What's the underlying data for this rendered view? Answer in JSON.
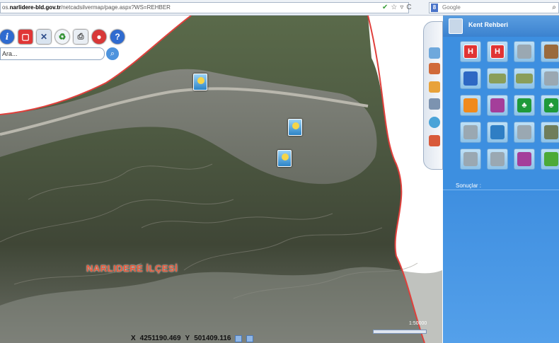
{
  "browser": {
    "url_prefix": "os.",
    "url_domain": "narlidere-bld.gov.tr",
    "url_path": "/netcadsilvermap/page.aspx?WS=REHBER",
    "search_engine_label": "Google",
    "url_icons": {
      "secure": "shield-check-icon",
      "bookmark": "star-icon",
      "dropdown": "chevron-down-icon",
      "reload": "reload-icon"
    }
  },
  "map": {
    "search_placeholder": "Ara...",
    "district_label": "NARLIDERE İLÇESİ",
    "coordinates": {
      "x_label": "X",
      "x_value": "4251190.469",
      "y_label": "Y",
      "y_value": "501409.116"
    },
    "scale_text": "1:50000",
    "toolbar_icons": [
      "info-icon",
      "square-icon",
      "cross-tools-icon",
      "recycle-icon",
      "print-icon",
      "stop-icon",
      "help-icon"
    ],
    "markers": [
      "location-marker",
      "location-marker",
      "location-marker"
    ],
    "colors": {
      "boundary": "#e0403c",
      "sea": "#ffffff"
    }
  },
  "panel": {
    "title": "Kent Rehberi",
    "results_label": "Sonuçlar :",
    "categories": [
      {
        "icon": "hospital-icon",
        "glyph": "H",
        "style": "ci-hosp"
      },
      {
        "icon": "hospital-icon",
        "glyph": "H",
        "style": "ci-hosp"
      },
      {
        "icon": "building-icon",
        "glyph": "",
        "style": "ci-gray"
      },
      {
        "icon": "fuel-icon",
        "glyph": "",
        "style": "ci-brown"
      },
      {
        "icon": "police-icon",
        "glyph": "",
        "style": "ci-blue"
      },
      {
        "icon": "park-icon",
        "glyph": "",
        "style": "ci-park"
      },
      {
        "icon": "park-icon",
        "glyph": "",
        "style": "ci-park"
      },
      {
        "icon": "building-icon",
        "glyph": "",
        "style": "ci-gray"
      },
      {
        "icon": "sport-icon",
        "glyph": "",
        "style": "ci-orange"
      },
      {
        "icon": "theatre-icon",
        "glyph": "",
        "style": "ci-purple"
      },
      {
        "icon": "forest-icon",
        "glyph": "♣",
        "style": "ci-green"
      },
      {
        "icon": "forest-icon",
        "glyph": "♣",
        "style": "ci-green"
      },
      {
        "icon": "building-icon",
        "glyph": "",
        "style": "ci-gray"
      },
      {
        "icon": "school-icon",
        "glyph": "",
        "style": "ci-teal"
      },
      {
        "icon": "building-icon",
        "glyph": "",
        "style": "ci-gray"
      },
      {
        "icon": "monument-icon",
        "glyph": "",
        "style": "ci-olive"
      },
      {
        "icon": "building-icon",
        "glyph": "",
        "style": "ci-gray"
      },
      {
        "icon": "building-icon",
        "glyph": "",
        "style": "ci-gray"
      },
      {
        "icon": "theatre-icon",
        "glyph": "",
        "style": "ci-purple"
      },
      {
        "icon": "playground-icon",
        "glyph": "",
        "style": "ci-lgreen"
      }
    ]
  }
}
